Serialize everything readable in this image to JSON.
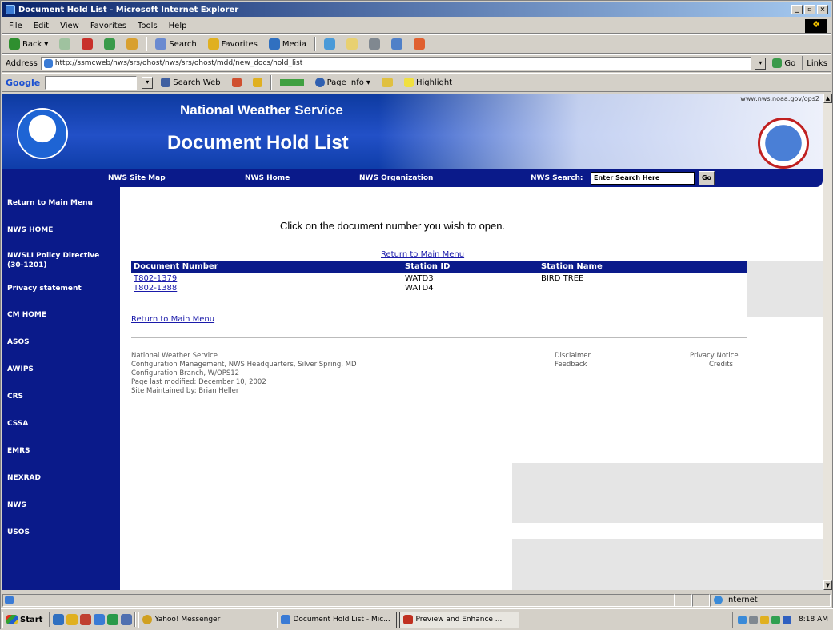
{
  "window": {
    "title": "Document Hold List - Microsoft Internet Explorer",
    "controls": [
      "_",
      "▫",
      "×"
    ]
  },
  "menubar": [
    "File",
    "Edit",
    "View",
    "Favorites",
    "Tools",
    "Help"
  ],
  "toolbar": {
    "back": "Back",
    "search": "Search",
    "favorites": "Favorites",
    "media": "Media"
  },
  "address": {
    "label": "Address",
    "url": "http://ssmcweb/nws/srs/ohost/nws/srs/ohost/mdd/new_docs/hold_list",
    "go": "Go",
    "links": "Links"
  },
  "googlebar": {
    "label": "Google",
    "search_web": "Search Web",
    "page_info": "Page Info",
    "highlight": "Highlight"
  },
  "banner": {
    "top_link": "www.nws.noaa.gov/ops2",
    "agency": "National Weather Service",
    "heading": "Document Hold List"
  },
  "nav": {
    "site_map": "NWS Site Map",
    "home": "NWS Home",
    "organization": "NWS Organization",
    "search_label": "NWS Search:",
    "search_placeholder": "Enter Search Here",
    "go": "Go"
  },
  "sidebar": [
    {
      "label": "Return to Main Menu"
    },
    {
      "label": "NWS HOME"
    },
    {
      "label": "NWSLI Policy Directive (30-1201)"
    },
    {
      "label": "Privacy statement"
    },
    {
      "label": "CM HOME"
    },
    {
      "label": "ASOS"
    },
    {
      "label": "AWIPS"
    },
    {
      "label": "CRS"
    },
    {
      "label": "CSSA"
    },
    {
      "label": "EMRS"
    },
    {
      "label": "NEXRAD"
    },
    {
      "label": "NWS"
    },
    {
      "label": "USOS"
    }
  ],
  "main": {
    "instruction": "Click on the document number you wish to open.",
    "return_link_top": "Return to Main Menu",
    "table": {
      "headers": [
        "Document Number",
        "Station ID",
        "Station Name"
      ],
      "rows": [
        {
          "doc": "T802-1379",
          "station_id": "WATD3",
          "station_name": "BIRD TREE"
        },
        {
          "doc": "T802-1388",
          "station_id": "WATD4",
          "station_name": ""
        }
      ]
    },
    "return_link_bottom": "Return to Main Menu"
  },
  "footer": {
    "left": [
      "National Weather Service",
      "Configuration Management, NWS Headquarters, Silver Spring, MD",
      "Configuration Branch, W/OPS12",
      "Page last modified: December 10, 2002",
      "Site Maintained by: Brian Heller"
    ],
    "middle": [
      "Disclaimer",
      "Feedback"
    ],
    "right": [
      "Privacy Notice",
      "Credits"
    ]
  },
  "status": {
    "left": "",
    "zone": "Internet"
  },
  "taskbar": {
    "start": "Start",
    "tasks": [
      {
        "label": "Yahoo! Messenger"
      },
      {
        "label": "Document Hold List - Mic..."
      },
      {
        "label": "Preview and Enhance ..."
      }
    ],
    "clock": "8:18 AM"
  },
  "colors": {
    "nav_blue": "#0a1a8a",
    "link_blue": "#1a1aaa",
    "banner_blue": "#2250c7"
  }
}
